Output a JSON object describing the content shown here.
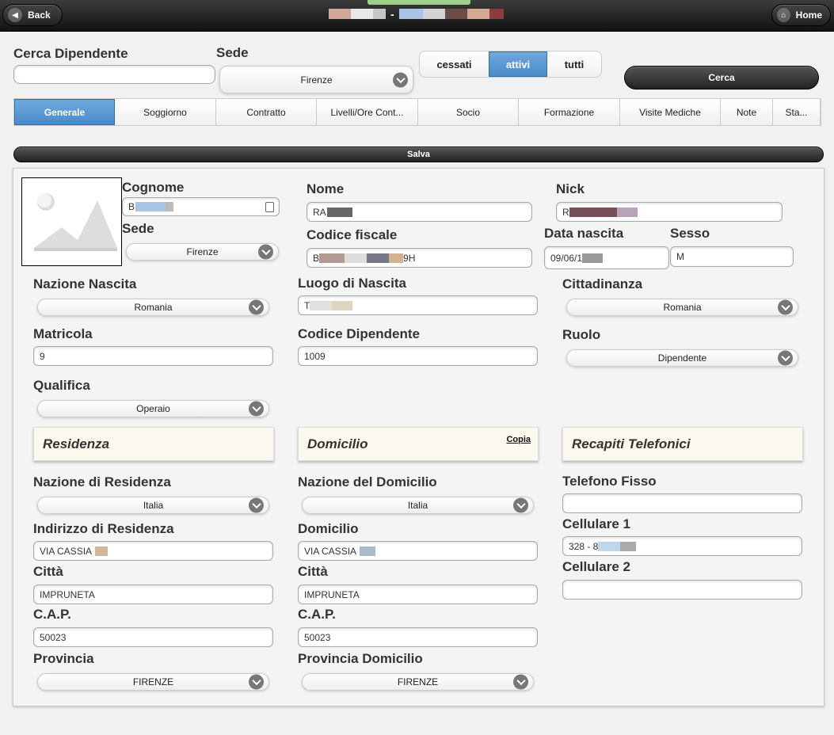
{
  "header": {
    "back_label": "Back",
    "home_label": "Home",
    "title_separator": "-",
    "title_redaction_colors_left": [
      "#d2a79a",
      "#e8e8e8",
      "#c7c7c7"
    ],
    "title_redaction_colors_right": [
      "#a8c5e6",
      "#d3d3d3",
      "#6b4d45",
      "#d6a891",
      "#8c3c3c"
    ]
  },
  "search": {
    "employee_label": "Cerca Dipendente",
    "employee_value": "",
    "sede_label": "Sede",
    "sede_value": "Firenze",
    "filter_options": [
      "cessati",
      "attivi",
      "tutti"
    ],
    "filter_selected": "attivi",
    "search_button": "Cerca"
  },
  "tabs": [
    {
      "label": "Generale",
      "active": true
    },
    {
      "label": "Soggiorno"
    },
    {
      "label": "Contratto"
    },
    {
      "label": "Livelli/Ore Cont..."
    },
    {
      "label": "Socio"
    },
    {
      "label": "Formazione"
    },
    {
      "label": "Visite Mediche"
    },
    {
      "label": "Note"
    },
    {
      "label": "Sta..."
    }
  ],
  "save_button": "Salva",
  "person": {
    "cognome_label": "Cognome",
    "cognome_value": "BI",
    "sede_label": "Sede",
    "sede_value": "Firenze",
    "nome_label": "Nome",
    "nome_value": "RA",
    "nick_label": "Nick",
    "nick_value": "R",
    "cf_label": "Codice fiscale",
    "cf_value_start": "B",
    "cf_value_end": "9H",
    "birth_label": "Data nascita",
    "birth_value": "09/06/1",
    "sex_label": "Sesso",
    "sex_value": "M",
    "nation_label": "Nazione Nascita",
    "nation_value": "Romania",
    "birthplace_label": "Luogo di Nascita",
    "birthplace_value": "T",
    "citizenship_label": "Cittadinanza",
    "citizenship_value": "Romania",
    "matricola_label": "Matricola",
    "matricola_value": "9",
    "code_label": "Codice Dipendente",
    "code_value": "1009",
    "role_label": "Ruolo",
    "role_value": "Dipendente",
    "qualifica_label": "Qualifica",
    "qualifica_value": "Operaio"
  },
  "residenza": {
    "title": "Residenza",
    "nation_label": "Nazione di Residenza",
    "nation_value": "Italia",
    "address_label": "Indirizzo di Residenza",
    "address_value": "VIA CASSIA",
    "city_label": "Città",
    "city_value": "IMPRUNETA",
    "cap_label": "C.A.P.",
    "cap_value": "50023",
    "province_label": "Provincia",
    "province_value": "FIRENZE"
  },
  "domicilio": {
    "title": "Domicilio",
    "copy_link": "Copia",
    "nation_label": "Nazione del Domicilio",
    "nation_value": "Italia",
    "address_label": "Domicilio",
    "address_value": "VIA CASSIA",
    "city_label": "Città",
    "city_value": "IMPRUNETA",
    "cap_label": "C.A.P.",
    "cap_value": "50023",
    "province_label": "Provincia Domicilio",
    "province_value": "FIRENZE"
  },
  "recapiti": {
    "title": "Recapiti Telefonici",
    "fixed_label": "Telefono Fisso",
    "fixed_value": "",
    "mobile1_label": "Cellulare 1",
    "mobile1_value": "328 - 8",
    "mobile2_label": "Cellulare 2",
    "mobile2_value": ""
  },
  "colors": {
    "accent": "#5b9bd5",
    "header_bg": "#1f1f1f",
    "section_bg": "#fdf8ee"
  },
  "icons": [
    "back-arrow-icon",
    "home-icon",
    "chevron-down-icon",
    "image-placeholder-icon",
    "id-card-icon"
  ]
}
